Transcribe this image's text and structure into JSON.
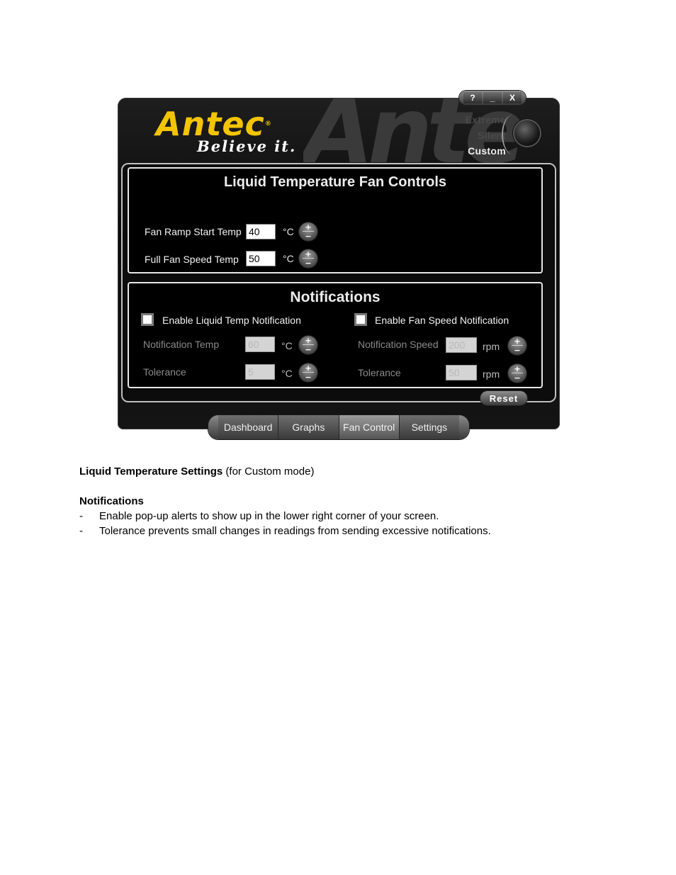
{
  "app": {
    "watermark": "Ante",
    "brand": {
      "logo": "Antec",
      "registered": "®",
      "tagline": "Believe it."
    },
    "title_buttons": [
      "?",
      "_",
      "X"
    ],
    "modes": {
      "items": [
        "Extreme",
        "Silent",
        "Custom"
      ],
      "selected": "Custom"
    },
    "liquid_panel": {
      "title": "Liquid Temperature Fan Controls",
      "rows": [
        {
          "label": "Fan Ramp Start Temp",
          "value": "40",
          "unit": "°C"
        },
        {
          "label": "Full Fan Speed Temp",
          "value": "50",
          "unit": "°C"
        }
      ]
    },
    "notifications_panel": {
      "title": "Notifications",
      "liquid": {
        "checkbox_label": "Enable Liquid Temp Notification",
        "checked": false,
        "temp_label": "Notification Temp",
        "temp_value": "60",
        "temp_unit": "°C",
        "tol_label": "Tolerance",
        "tol_value": "5",
        "tol_unit": "°C"
      },
      "fan": {
        "checkbox_label": "Enable Fan Speed Notification",
        "checked": false,
        "speed_label": "Notification Speed",
        "speed_value": "200",
        "speed_unit": "rpm",
        "tol_label": "Tolerance",
        "tol_value": "50",
        "tol_unit": "rpm"
      }
    },
    "stepper": {
      "plus": "+",
      "minus": "−"
    },
    "reset_label": "Reset",
    "tabs": [
      {
        "label": "Dashboard",
        "active": false
      },
      {
        "label": "Graphs",
        "active": false
      },
      {
        "label": "Fan Control",
        "active": true
      },
      {
        "label": "Settings",
        "active": false
      }
    ],
    "colors": {
      "brand_yellow": "#f3c400",
      "background": "#0b0b0b",
      "panel_border": "#e6e6e6"
    }
  },
  "document": {
    "heading_bold": "Liquid Temperature Settings",
    "heading_rest": " (for Custom mode)",
    "subheading": "Notifications",
    "bullet_marker": "-",
    "bullets": [
      "Enable pop-up alerts to show up in the lower right corner of your screen.",
      "Tolerance prevents small changes in readings from sending excessive notifications."
    ]
  }
}
